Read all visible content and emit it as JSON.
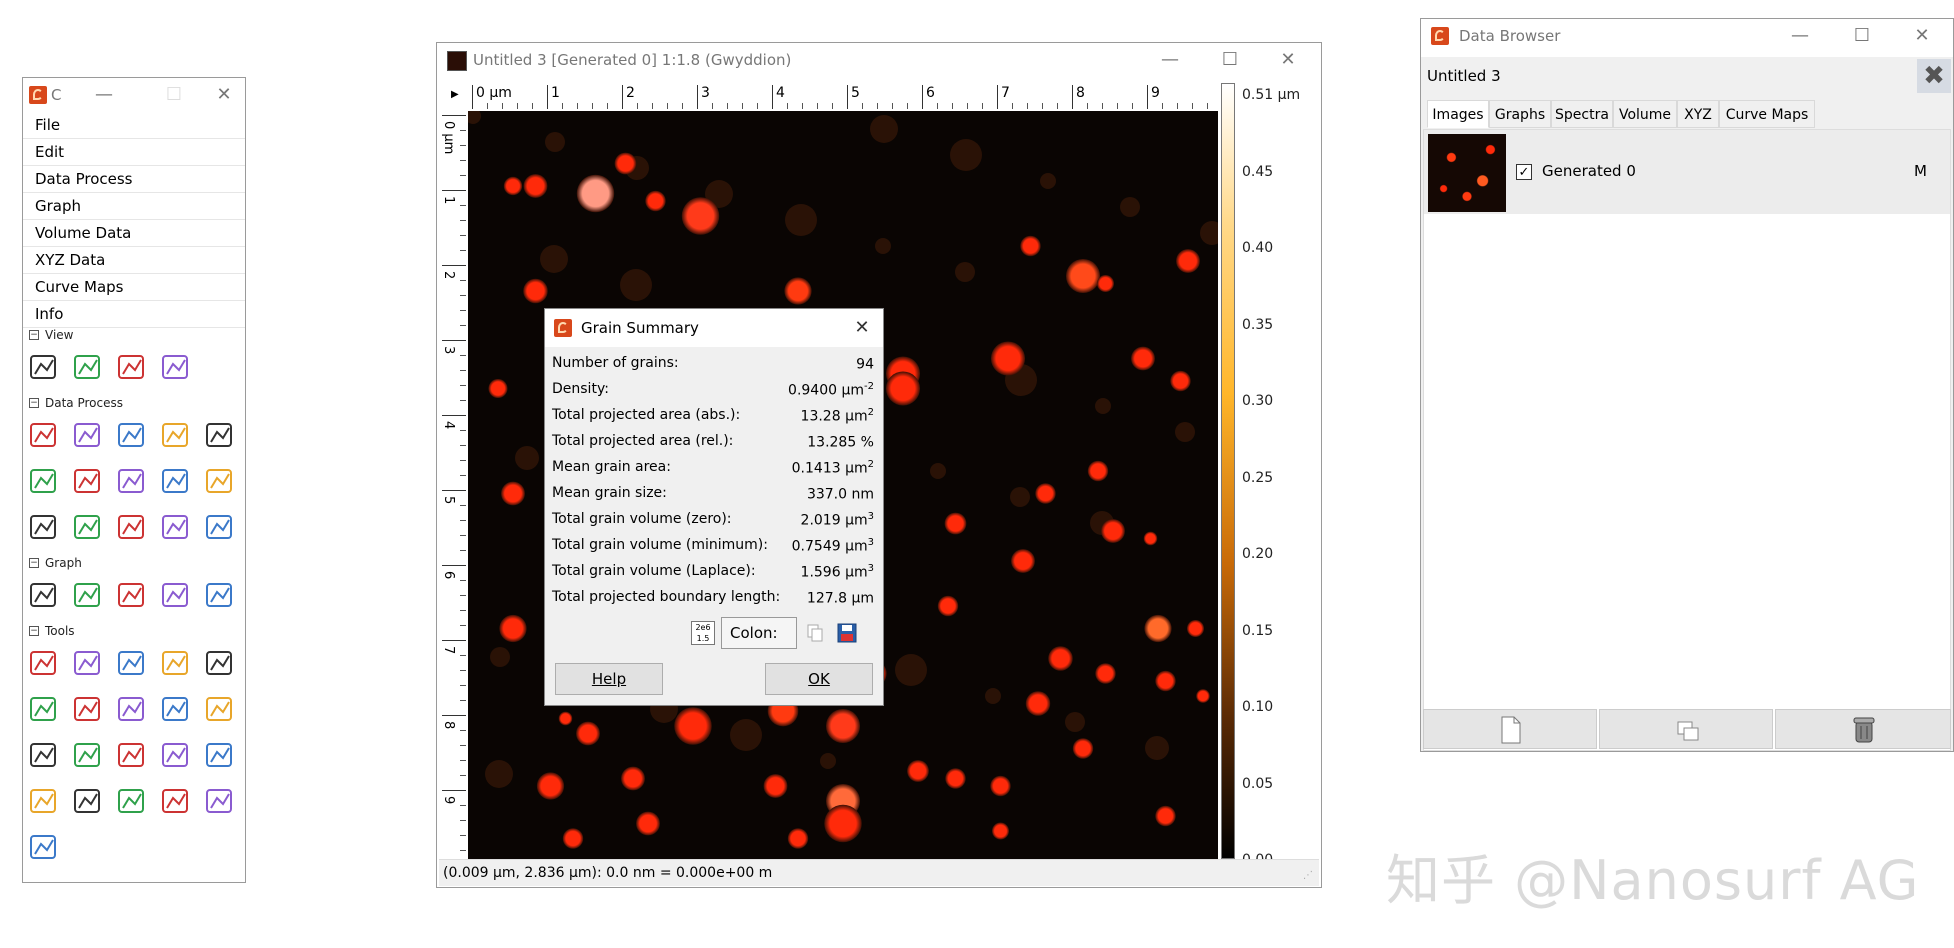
{
  "toolbox": {
    "title": "C",
    "menu": [
      "File",
      "Edit",
      "Data Process",
      "Graph",
      "Volume Data",
      "XYZ Data",
      "Curve Maps",
      "Info"
    ],
    "sections": {
      "view": "View",
      "data_process": "Data Process",
      "graph": "Graph",
      "tools": "Tools"
    },
    "view_icons": [
      "zoom-in-icon",
      "zoom-1-1-icon",
      "zoom-out-icon",
      "3d-view-icon"
    ],
    "data_process_icons": [
      "fix-zero-icon",
      "crop-icon",
      "scale-icon",
      "duplicate-icon",
      "gradient-icon",
      "edge-detect-icon",
      "rows-icon",
      "align-rows-icon",
      "grains-icon",
      "watershed-icon",
      "remove-grains-icon",
      "grain-distribution-icon",
      "sphere-icon",
      "shade-icon",
      "mask-icon"
    ],
    "graph_icons": [
      "graph-fit-icon",
      "graph-peak-icon",
      "graph-measure-icon",
      "graph-cut-icon",
      "graph-export-icon"
    ],
    "tools_icons": [
      "pointer-icon",
      "ruler-icon",
      "crosshair-icon",
      "spectro-icon",
      "profile-icon",
      "level-icon",
      "stats-icon",
      "curve-icon",
      "selection-icon",
      "roughness-icon",
      "leveling-tool-icon",
      "triangle-icon",
      "filter-icon",
      "line-correct-icon",
      "pencil-icon",
      "mask-editor-icon",
      "grain-remove-icon",
      "mark-icon",
      "scale-tool-icon",
      "export-tool-icon",
      "path-level-icon"
    ]
  },
  "image_window": {
    "title": "Untitled 3 [Generated 0] 1:1.8 (Gwyddion)",
    "x_ticks": [
      "0 μm",
      "1",
      "2",
      "3",
      "4",
      "5",
      "6",
      "7",
      "8",
      "9"
    ],
    "y_ticks": [
      "0 μm",
      "1",
      "2",
      "3",
      "4",
      "5",
      "6",
      "7",
      "8",
      "9"
    ],
    "colorbar_labels": [
      "0.51 μm",
      "0.45",
      "0.40",
      "0.35",
      "0.30",
      "0.25",
      "0.20",
      "0.15",
      "0.10",
      "0.05",
      "0.00"
    ],
    "status": "(0.009 μm, 2.836 μm): 0.0 nm = 0.000e+00 m"
  },
  "grain_summary": {
    "title": "Grain Summary",
    "rows": [
      {
        "label": "Number of grains:",
        "value": "94",
        "sup": ""
      },
      {
        "label": "Density:",
        "value": "0.9400 μm",
        "sup": "-2"
      },
      {
        "label": "Total projected area (abs.):",
        "value": "13.28 μm",
        "sup": "2"
      },
      {
        "label": "Total projected area (rel.):",
        "value": "13.285 %",
        "sup": ""
      },
      {
        "label": "Mean grain area:",
        "value": "0.1413 μm",
        "sup": "2"
      },
      {
        "label": "Mean grain size:",
        "value": "337.0 nm",
        "sup": ""
      },
      {
        "label": "Total grain volume (zero):",
        "value": "2.019 μm",
        "sup": "3"
      },
      {
        "label": "Total grain volume (minimum):",
        "value": "0.7549 μm",
        "sup": "3"
      },
      {
        "label": "Total grain volume (Laplace):",
        "value": "1.596 μm",
        "sup": "3"
      },
      {
        "label": "Total projected boundary length:",
        "value": "127.8 μm",
        "sup": ""
      }
    ],
    "format_value": "Colon:",
    "help_label": "Help",
    "ok_label": "OK"
  },
  "data_browser": {
    "title": "Data Browser",
    "file_name": "Untitled 3",
    "tabs": [
      "Images",
      "Graphs",
      "Spectra",
      "Volume",
      "XYZ",
      "Curve Maps"
    ],
    "active_tab": "Images",
    "items": [
      {
        "name": "Generated 0",
        "checked": true,
        "flag": "M"
      }
    ]
  },
  "watermark": "知乎 @Nanosurf AG",
  "grains": [
    [
      0.17,
      0.11,
      0.055,
      "#ff9a84"
    ],
    [
      0.31,
      0.14,
      0.055,
      "#ff3a1a"
    ],
    [
      0.09,
      0.1,
      0.035,
      "#ff2a0a"
    ],
    [
      0.21,
      0.07,
      0.032,
      "#ff2a0a"
    ],
    [
      0.82,
      0.22,
      0.05,
      "#ff4a1a"
    ],
    [
      0.75,
      0.18,
      0.03,
      "#ff2a0a"
    ],
    [
      0.72,
      0.33,
      0.05,
      "#ff2a0a"
    ],
    [
      0.9,
      0.33,
      0.035,
      "#ff2a0a"
    ],
    [
      0.96,
      0.2,
      0.035,
      "#ff2a0a"
    ],
    [
      0.44,
      0.24,
      0.04,
      "#ff3a10"
    ],
    [
      0.09,
      0.24,
      0.036,
      "#ff2a0a"
    ],
    [
      0.58,
      0.35,
      0.05,
      "#ff2a0a"
    ],
    [
      0.06,
      0.1,
      0.027,
      "#ff2a0a"
    ],
    [
      0.25,
      0.12,
      0.03,
      "#ff2a0a"
    ],
    [
      0.85,
      0.23,
      0.025,
      "#ff2a0a"
    ],
    [
      0.04,
      0.37,
      0.028,
      "#ff2a0a"
    ],
    [
      0.58,
      0.37,
      0.05,
      "#ff2a0a"
    ],
    [
      0.95,
      0.36,
      0.03,
      "#ff2a0a"
    ],
    [
      0.84,
      0.48,
      0.03,
      "#ff2a0a"
    ],
    [
      0.65,
      0.55,
      0.032,
      "#ff2a0a"
    ],
    [
      0.77,
      0.51,
      0.03,
      "#ff2a0a"
    ],
    [
      0.86,
      0.56,
      0.035,
      "#ff2a0a"
    ],
    [
      0.91,
      0.57,
      0.02,
      "#ff2a0a"
    ],
    [
      0.74,
      0.6,
      0.035,
      "#ff2a0a"
    ],
    [
      0.06,
      0.51,
      0.035,
      "#ff2a0a"
    ],
    [
      0.92,
      0.69,
      0.04,
      "#ff6a2a"
    ],
    [
      0.79,
      0.73,
      0.036,
      "#ff2a0a"
    ],
    [
      0.76,
      0.79,
      0.036,
      "#ff2a0a"
    ],
    [
      0.85,
      0.75,
      0.03,
      "#ff2a0a"
    ],
    [
      0.93,
      0.76,
      0.03,
      "#ff2a0a"
    ],
    [
      0.97,
      0.69,
      0.025,
      "#ff2a0a"
    ],
    [
      0.64,
      0.66,
      0.03,
      "#ff2a0a"
    ],
    [
      0.54,
      0.75,
      0.04,
      "#ff2a0a"
    ],
    [
      0.5,
      0.82,
      0.05,
      "#ff3a1a"
    ],
    [
      0.42,
      0.8,
      0.045,
      "#ff3a10"
    ],
    [
      0.3,
      0.82,
      0.055,
      "#ff2a0a"
    ],
    [
      0.16,
      0.83,
      0.035,
      "#ff2a0a"
    ],
    [
      0.34,
      0.76,
      0.038,
      "#ff2a0a"
    ],
    [
      0.13,
      0.81,
      0.02,
      "#ff2a0a"
    ],
    [
      0.06,
      0.69,
      0.04,
      "#ff2a0a"
    ],
    [
      0.11,
      0.9,
      0.04,
      "#ff2a0a"
    ],
    [
      0.22,
      0.89,
      0.035,
      "#ff2a0a"
    ],
    [
      0.41,
      0.9,
      0.035,
      "#ff2a0a"
    ],
    [
      0.5,
      0.92,
      0.05,
      "#ff6a3a"
    ],
    [
      0.5,
      0.95,
      0.055,
      "#ff2a0a"
    ],
    [
      0.6,
      0.88,
      0.032,
      "#ff2a0a"
    ],
    [
      0.65,
      0.89,
      0.03,
      "#ff2a0a"
    ],
    [
      0.71,
      0.9,
      0.03,
      "#ff2a0a"
    ],
    [
      0.82,
      0.85,
      0.03,
      "#ff2a0a"
    ],
    [
      0.93,
      0.94,
      0.03,
      "#ff2a0a"
    ],
    [
      0.71,
      0.96,
      0.025,
      "#ff2a0a"
    ],
    [
      0.24,
      0.95,
      0.035,
      "#ff2a0a"
    ],
    [
      0.14,
      0.97,
      0.03,
      "#ff2a0a"
    ],
    [
      0.44,
      0.97,
      0.03,
      "#ff2a0a"
    ],
    [
      0.98,
      0.78,
      0.02,
      "#ff2a0a"
    ],
    [
      0.12,
      0.56,
      0.02,
      "#ff2a0a"
    ]
  ]
}
